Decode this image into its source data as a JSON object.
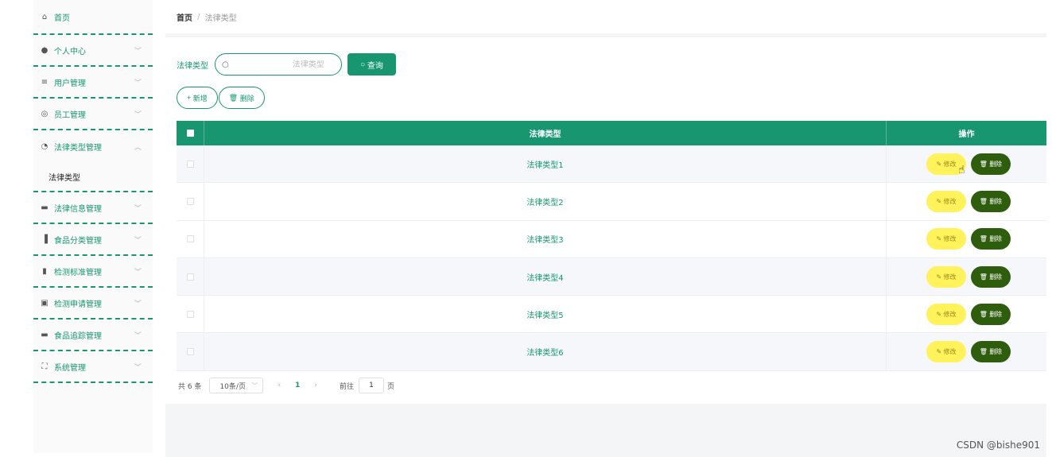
{
  "sidebar": {
    "items": [
      {
        "label": "首页",
        "icon": "home-icon",
        "glyph": "⌂"
      },
      {
        "label": "个人中心",
        "icon": "user-icon",
        "glyph": "●"
      },
      {
        "label": "用户管理",
        "icon": "list-icon",
        "glyph": "≡"
      },
      {
        "label": "员工管理",
        "icon": "globe-icon",
        "glyph": "◎"
      },
      {
        "label": "法律类型管理",
        "icon": "gauge-icon",
        "glyph": "◔"
      },
      {
        "label": "法律信息管理",
        "icon": "ticket-icon",
        "glyph": "▬"
      },
      {
        "label": "食品分类管理",
        "icon": "bars-icon",
        "glyph": "▐"
      },
      {
        "label": "检测标准管理",
        "icon": "chart-icon",
        "glyph": "▮"
      },
      {
        "label": "检测申请管理",
        "icon": "clipboard-icon",
        "glyph": "▣"
      },
      {
        "label": "食品追踪管理",
        "icon": "briefcase-icon",
        "glyph": "▬"
      },
      {
        "label": "系统管理",
        "icon": "frame-icon",
        "glyph": "⛶"
      }
    ],
    "submenu_label": "法律类型"
  },
  "breadcrumb": {
    "home": "首页",
    "separator": "/",
    "current": "法律类型"
  },
  "search": {
    "label": "法律类型",
    "placeholder": "法律类型",
    "button_label": "查询"
  },
  "actions": {
    "add_label": "新增",
    "delete_label": "删除"
  },
  "table": {
    "headers": {
      "name": "法律类型",
      "ops": "操作"
    },
    "rows": [
      {
        "name": "法律类型1"
      },
      {
        "name": "法律类型2"
      },
      {
        "name": "法律类型3"
      },
      {
        "name": "法律类型4"
      },
      {
        "name": "法律类型5"
      },
      {
        "name": "法律类型6"
      }
    ],
    "edit_label": "修改",
    "delete_label": "删除"
  },
  "pagination": {
    "total_text": "共 6 条",
    "page_size": "10条/页",
    "current_page": "1",
    "goto_label": "前往",
    "goto_value": "1",
    "page_suffix": "页"
  },
  "watermark": "CSDN @bishe901",
  "colors": {
    "primary": "#17966f",
    "edit": "#fff25a",
    "delete": "#2f5d0e"
  }
}
